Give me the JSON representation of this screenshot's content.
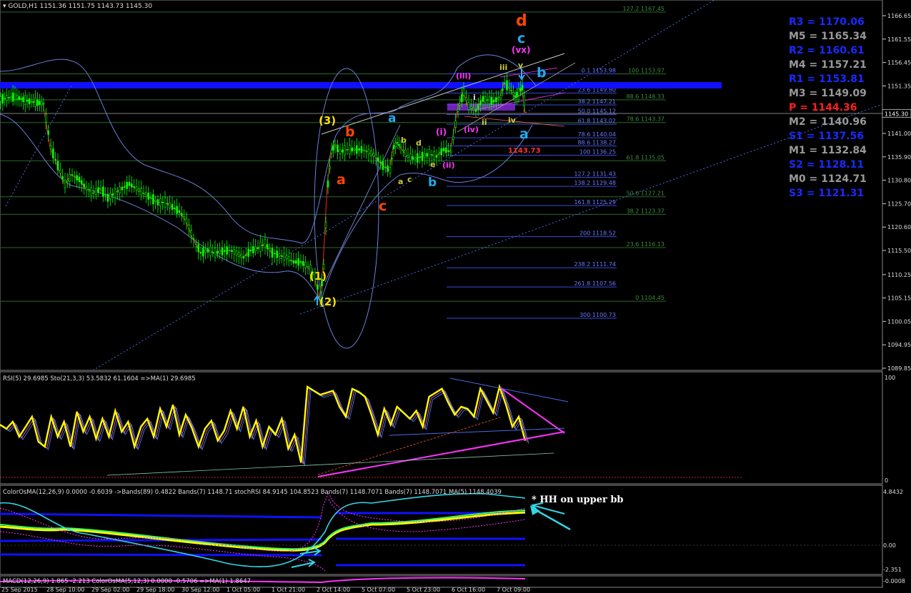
{
  "window_title": "GOLD,H1  1151.36 1151.75 1143.73 1145.30",
  "colors": {
    "background": "#000000",
    "bull": "#00ff00",
    "bear": "#00ff00",
    "blue_band": "#0000ff",
    "bb": "#6a7fd8",
    "yellow": "#ffff00",
    "magenta": "#ff33ff",
    "cyan": "#33d6e6",
    "red": "#ff3333",
    "orange": "#ff4400",
    "green_grid": "#2a6a2a"
  },
  "price_axis": {
    "ticks": [
      "1166.65",
      "1161.55",
      "1156.45",
      "1151.35",
      "1145.30",
      "1141.00",
      "1135.90",
      "1130.80",
      "1125.70",
      "1120.60",
      "1115.50",
      "1110.25",
      "1105.15",
      "1100.05",
      "1094.95",
      "1089.85"
    ],
    "current": "1145.30"
  },
  "time_axis": [
    "25 Sep 2015",
    "28 Sep 10:00",
    "29 Sep 02:00",
    "29 Sep 18:00",
    "30 Sep 12:00",
    "1 Oct 05:00",
    "1 Oct 21:00",
    "2 Oct 14:00",
    "5 Oct 07:00",
    "5 Oct 23:00",
    "6 Oct 16:00",
    "7 Oct 09:00"
  ],
  "pivots": [
    {
      "label": "R3 = 1170.06",
      "kind": "r"
    },
    {
      "label": "M5 = 1165.34",
      "kind": "m"
    },
    {
      "label": "R2 = 1160.61",
      "kind": "r"
    },
    {
      "label": "M4 = 1157.21",
      "kind": "m"
    },
    {
      "label": "R1 = 1153.81",
      "kind": "r"
    },
    {
      "label": "M3 = 1149.09",
      "kind": "m"
    },
    {
      "label": "P  = 1144.36",
      "kind": "p"
    },
    {
      "label": "M2 = 1140.96",
      "kind": "m"
    },
    {
      "label": "S1 = 1137.56",
      "kind": "r"
    },
    {
      "label": "M1 = 1132.84",
      "kind": "m"
    },
    {
      "label": "S2 = 1128.11",
      "kind": "r"
    },
    {
      "label": "M0 = 1124.71",
      "kind": "m"
    },
    {
      "label": "S3 = 1121.31",
      "kind": "r"
    }
  ],
  "fib_green": [
    {
      "label": "127.2  1167.45",
      "price": 1167.45
    },
    {
      "label": "100  1153.97",
      "price": 1153.97
    },
    {
      "label": "88.6  1148.33",
      "price": 1148.33
    },
    {
      "label": "78.6  1143.37",
      "price": 1143.37
    },
    {
      "label": "61.8  1135.05",
      "price": 1135.05
    },
    {
      "label": "50.0  1127.21",
      "price": 1127.21
    },
    {
      "label": "38.2  1123.37",
      "price": 1123.37
    },
    {
      "label": "23.6  1116.13",
      "price": 1116.13
    },
    {
      "label": "0  1104.45",
      "price": 1104.45
    }
  ],
  "fib_blue": [
    {
      "label": "0.1  1153.98",
      "price": 1153.98
    },
    {
      "label": "23.6  1149.80",
      "price": 1149.8
    },
    {
      "label": "38.2  1147.21",
      "price": 1147.21
    },
    {
      "label": "50.0  1145.12",
      "price": 1145.12
    },
    {
      "label": "61.8  1143.02",
      "price": 1143.02
    },
    {
      "label": "78.6  1140.04",
      "price": 1140.04
    },
    {
      "label": "88.6  1138.27",
      "price": 1138.27
    },
    {
      "label": "100  1136.25",
      "price": 1136.25
    },
    {
      "label": "127.2  1131.43",
      "price": 1131.43
    },
    {
      "label": "138.2  1129.48",
      "price": 1129.48
    },
    {
      "label": "161.8  1125.29",
      "price": 1125.29
    },
    {
      "label": "200  1118.52",
      "price": 1118.52
    },
    {
      "label": "238.2  1111.74",
      "price": 1111.74
    },
    {
      "label": "261.8  1107.56",
      "price": 1107.56
    },
    {
      "label": "300  1100.73",
      "price": 1100.73
    }
  ],
  "annotations": {
    "low_price": "1143.73",
    "w_d": "d",
    "w_c_top": "c",
    "w_vx": "(vx)",
    "w_v": "v",
    "w_b_right": "b",
    "w_iii_mag": "(iii)",
    "w_iii": "iii",
    "w_i": "i",
    "w_ii": "ii",
    "w_iv": "iv",
    "w_iv_mag": "(iv)",
    "w_i_mag": "(i)",
    "w_ii_mag": "(ii)",
    "w_a_right": "a",
    "w_3": "(3)",
    "w_b_red": "b",
    "w_a_red": "a",
    "w_c_red": "c",
    "w_1": "(1)",
    "w_2": "(2)",
    "w_a_blue": "a",
    "w_b_blue": "b",
    "w_b_small": "b",
    "w_d_small": "d",
    "w_a_small": "a",
    "w_c_small": "c",
    "w_e_small": "e",
    "hh_note": "* HH on upper bb"
  },
  "rsi_panel": {
    "header": "RSI(5) 29.6985  Sto(21,3,3) 53.5832 61.1604  =>MA(1) 29.6985",
    "scale_top": "100",
    "scale_bottom": "0"
  },
  "osma_panel": {
    "header": "ColorOsMA(12,26,9) 0.0000 -0.6039  ->Bands(89) 0.4822  Bands(7) 1148.71  stochRSI 84.9145 104.8523  Bands(7) 1148.7071  Bands(7) 1148.7071  MA(5) 1148.4039",
    "scale": [
      "4.8432",
      "0.00",
      "-2.351"
    ]
  },
  "macd_panel": {
    "header": "MACD(12,26,9) 1.865 -2.213  ColorOsMA(5,12,3) 0.0000 -0.5706  =>MA(1) 1.8647",
    "scale": "-0.0008"
  },
  "chart_data": {
    "type": "line",
    "title": "GOLD,H1",
    "ohlc_last": {
      "open": 1151.36,
      "high": 1151.75,
      "low": 1143.73,
      "close": 1145.3
    },
    "ylim": [
      1089.85,
      1170.0
    ],
    "close_path": [
      [
        0,
        1148.5
      ],
      [
        20,
        1149
      ],
      [
        40,
        1148
      ],
      [
        60,
        1147.5
      ],
      [
        70,
        1138
      ],
      [
        80,
        1134
      ],
      [
        90,
        1130
      ],
      [
        100,
        1132
      ],
      [
        110,
        1131
      ],
      [
        120,
        1129
      ],
      [
        130,
        1128
      ],
      [
        140,
        1129
      ],
      [
        150,
        1127
      ],
      [
        160,
        1128
      ],
      [
        170,
        1129
      ],
      [
        180,
        1130
      ],
      [
        190,
        1129
      ],
      [
        200,
        1128
      ],
      [
        210,
        1127
      ],
      [
        220,
        1126
      ],
      [
        230,
        1126
      ],
      [
        240,
        1125
      ],
      [
        250,
        1124
      ],
      [
        260,
        1122
      ],
      [
        270,
        1118
      ],
      [
        280,
        1115
      ],
      [
        290,
        1115.5
      ],
      [
        300,
        1115
      ],
      [
        310,
        1115.3
      ],
      [
        320,
        1115.6
      ],
      [
        330,
        1115
      ],
      [
        340,
        1114
      ],
      [
        350,
        1115.5
      ],
      [
        360,
        1116
      ],
      [
        370,
        1117
      ],
      [
        380,
        1115
      ],
      [
        390,
        1114.5
      ],
      [
        400,
        1114
      ],
      [
        410,
        1113
      ],
      [
        420,
        1113
      ],
      [
        430,
        1112
      ],
      [
        440,
        1110
      ],
      [
        447,
        1105
      ],
      [
        452,
        1112
      ],
      [
        458,
        1130
      ],
      [
        463,
        1137
      ],
      [
        468,
        1138.5
      ],
      [
        475,
        1137
      ],
      [
        485,
        1137.5
      ],
      [
        495,
        1137.5
      ],
      [
        505,
        1137.5
      ],
      [
        515,
        1137
      ],
      [
        525,
        1136
      ],
      [
        535,
        1134
      ],
      [
        545,
        1133
      ],
      [
        550,
        1138
      ],
      [
        555,
        1139
      ],
      [
        560,
        1138
      ],
      [
        570,
        1136
      ],
      [
        580,
        1135.5
      ],
      [
        590,
        1136
      ],
      [
        600,
        1136.5
      ],
      [
        610,
        1136
      ],
      [
        620,
        1137.5
      ],
      [
        630,
        1137
      ],
      [
        640,
        1146
      ],
      [
        648,
        1150
      ],
      [
        655,
        1147
      ],
      [
        665,
        1146
      ],
      [
        675,
        1148.5
      ],
      [
        690,
        1148
      ],
      [
        700,
        1149
      ],
      [
        705,
        1152
      ],
      [
        712,
        1151
      ],
      [
        720,
        1149
      ],
      [
        725,
        1150
      ],
      [
        730,
        1151
      ],
      [
        735,
        1145.3
      ]
    ],
    "rsi_values": [
      52,
      48,
      55,
      40,
      50,
      60,
      35,
      30,
      60,
      40,
      55,
      30,
      65,
      45,
      60,
      38,
      58,
      40,
      66,
      45,
      55,
      30,
      50,
      58,
      40,
      68,
      50,
      72,
      42,
      62,
      48,
      30,
      48,
      56,
      36,
      46,
      66,
      48,
      70,
      40,
      56,
      30,
      50,
      42,
      58,
      28,
      42,
      14,
      90,
      86,
      82,
      84,
      86,
      70,
      60,
      88,
      85,
      80,
      62,
      42,
      68,
      52,
      70,
      64,
      58,
      66,
      50,
      80,
      84,
      88,
      74,
      62,
      70,
      68,
      60,
      88,
      76,
      64,
      90,
      72,
      50,
      60,
      36
    ]
  }
}
